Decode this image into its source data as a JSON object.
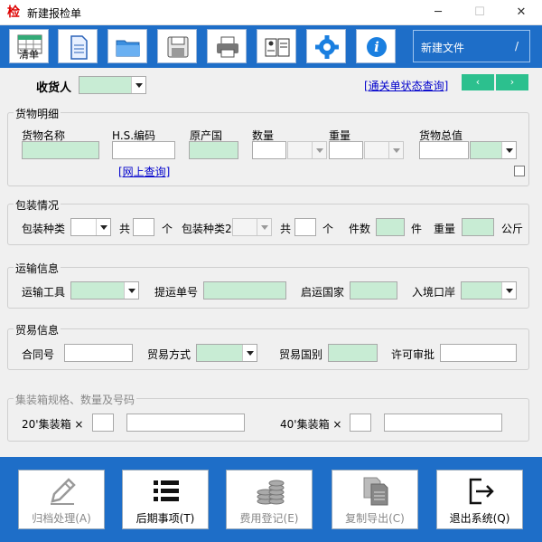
{
  "window": {
    "icon": "检",
    "title": "新建报检单",
    "minimize": "─",
    "maximize": "☐",
    "close": "✕"
  },
  "toolbar": {
    "list_label": "清单",
    "new_file_label": "新建文件",
    "new_file_suffix": "/"
  },
  "receiver": {
    "label": "收货人",
    "status_link": "[通关单状态查询]",
    "prev": "‹",
    "next": "›"
  },
  "goods": {
    "title": "货物明细",
    "name_label": "货物名称",
    "hs_label": "H.S.编码",
    "origin_label": "原产国",
    "qty_label": "数量",
    "weight_label": "重量",
    "total_label": "货物总值",
    "online_link": "[网上查询]"
  },
  "packing": {
    "title": "包装情况",
    "type_label": "包装种类",
    "total_label": "共",
    "unit_label": "个",
    "type2_label": "包装种类2",
    "total2_label": "共",
    "unit2_label": "个",
    "pieces_label": "件数",
    "pieces_unit": "件",
    "weight_label": "重量",
    "weight_unit": "公斤"
  },
  "transport": {
    "title": "运输信息",
    "tool_label": "运输工具",
    "bill_label": "提运单号",
    "country_label": "启运国家",
    "port_label": "入境口岸"
  },
  "trade": {
    "title": "贸易信息",
    "contract_label": "合同号",
    "mode_label": "贸易方式",
    "country_label": "贸易国别",
    "license_label": "许可审批"
  },
  "container": {
    "title": "集装箱规格、数量及号码",
    "c20_label": "20'集装箱 ×",
    "c40_label": "40'集装箱 ×"
  },
  "actions": {
    "archive": "归档处理(A)",
    "follow": "后期事项(T)",
    "fee": "费用登记(E)",
    "copy": "复制导出(C)",
    "exit": "退出系统(Q)"
  },
  "colors": {
    "toolbar": "#1e6ec8",
    "field_green": "#c8ecd4",
    "nav_green": "#2cc08e",
    "link": "#0000cc"
  }
}
